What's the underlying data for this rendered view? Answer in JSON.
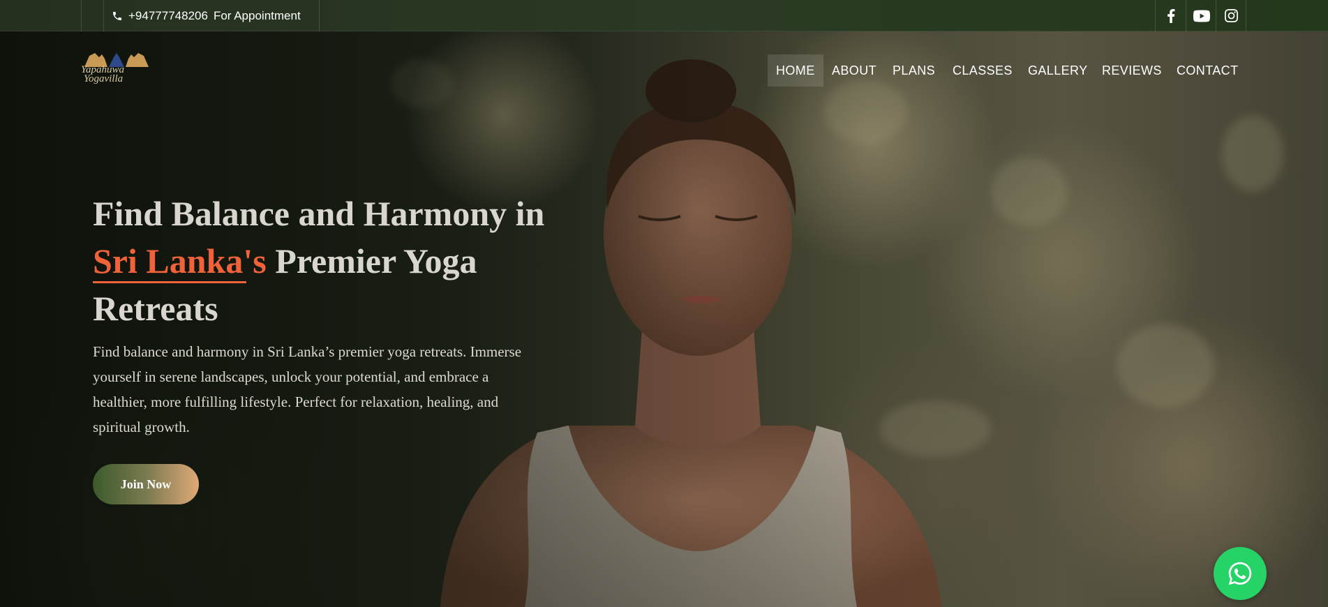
{
  "topbar": {
    "phone_icon": "phone-icon",
    "phone": "+94777748206",
    "appointment_label": "For Appointment",
    "social": [
      {
        "name": "facebook",
        "icon": "facebook-icon"
      },
      {
        "name": "youtube",
        "icon": "youtube-icon"
      },
      {
        "name": "instagram",
        "icon": "instagram-icon"
      }
    ]
  },
  "logo": {
    "line1": "Yapahuwa",
    "line2": "Yogavilla"
  },
  "nav": {
    "items": [
      "HOME",
      "ABOUT",
      "PLANS",
      "CLASSES",
      "GALLERY",
      "REVIEWS",
      "CONTACT"
    ],
    "active": "HOME"
  },
  "hero": {
    "title_part1": "Find Balance and Harmony in",
    "title_accent": "Sri Lanka's",
    "title_part2": "Premier Yoga",
    "title_part3": "Retreats",
    "description": "Find balance and harmony in Sri Lanka’s premier yoga retreats. Immerse yourself in serene landscapes, unlock your potential, and embrace a healthier, more fulfilling lifestyle. Perfect for relaxation, healing, and spiritual growth.",
    "cta_label": "Join Now"
  },
  "floating": {
    "whatsapp_icon": "whatsapp-icon"
  },
  "colors": {
    "accent": "#f0623a",
    "whatsapp": "#25d366",
    "topbar": "#2a3a24",
    "cta_start": "#3b5a2b",
    "cta_end": "#e0a877"
  }
}
